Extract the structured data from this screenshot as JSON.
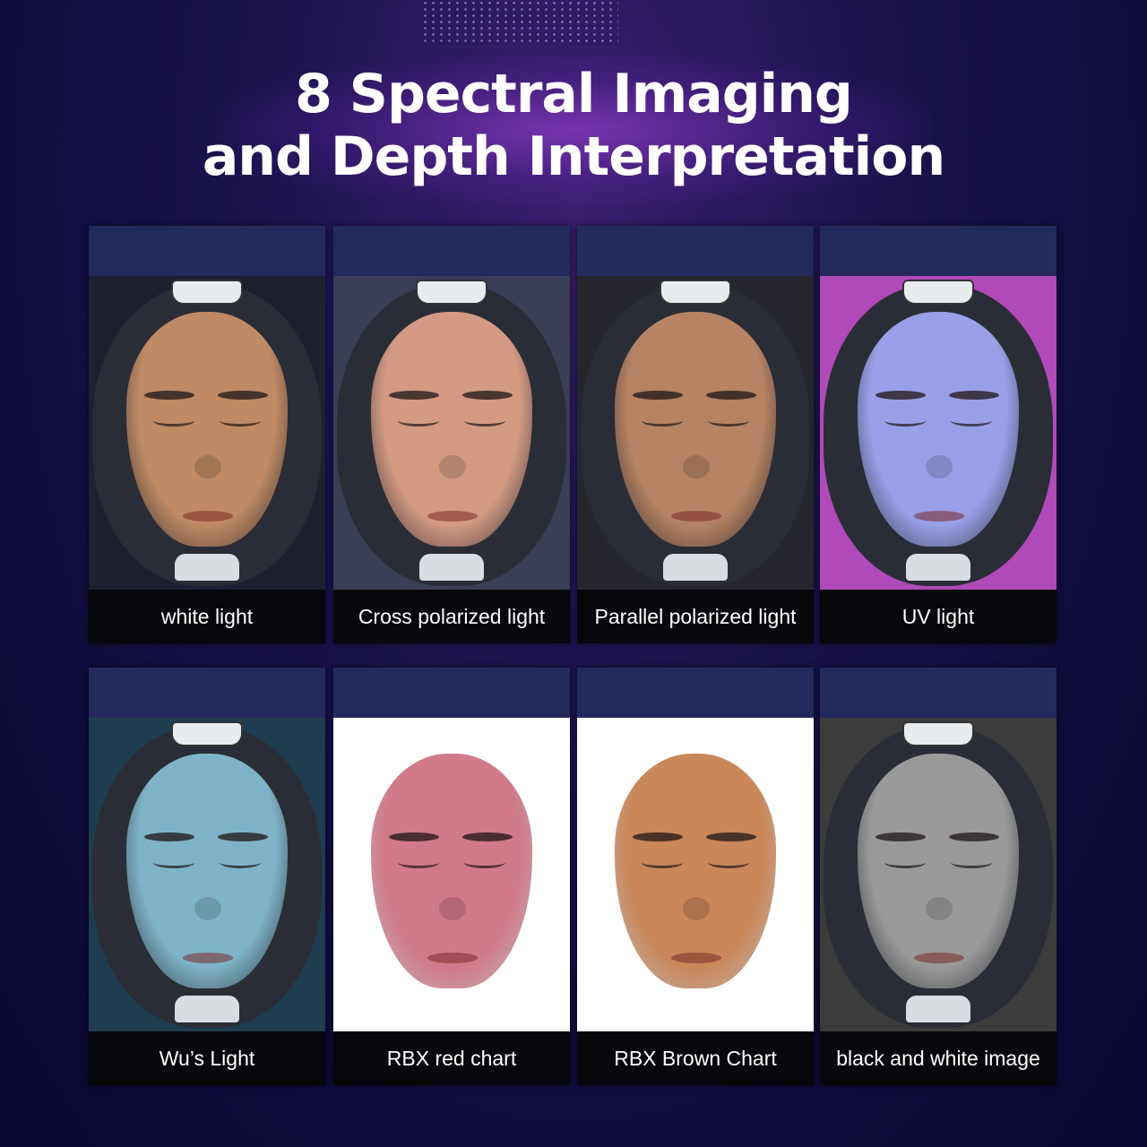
{
  "header": {
    "title_line1": "8 Spectral Imaging",
    "title_line2": "and Depth Interpretation"
  },
  "panels": [
    {
      "caption": "white light",
      "bg": "#1e2030",
      "skin": "#c08a64"
    },
    {
      "caption": "Cross polarized light",
      "bg": "#3a3e56",
      "skin": "#d49a84"
    },
    {
      "caption": "Parallel polarized light",
      "bg": "#26262e",
      "skin": "#b78364"
    },
    {
      "caption": "UV light",
      "bg": "#b04ab8",
      "skin": "#9aa0e8"
    },
    {
      "caption": "Wu’s Light",
      "bg": "#1f3c50",
      "skin": "#7fb4c8"
    },
    {
      "caption": "RBX red chart",
      "bg": "#ffffff",
      "skin": "#d07a8c"
    },
    {
      "caption": "RBX Brown Chart",
      "bg": "#ffffff",
      "skin": "#c9875a"
    },
    {
      "caption": "black and white image",
      "bg": "#3c3c3c",
      "skin": "#9a9a9a"
    }
  ]
}
